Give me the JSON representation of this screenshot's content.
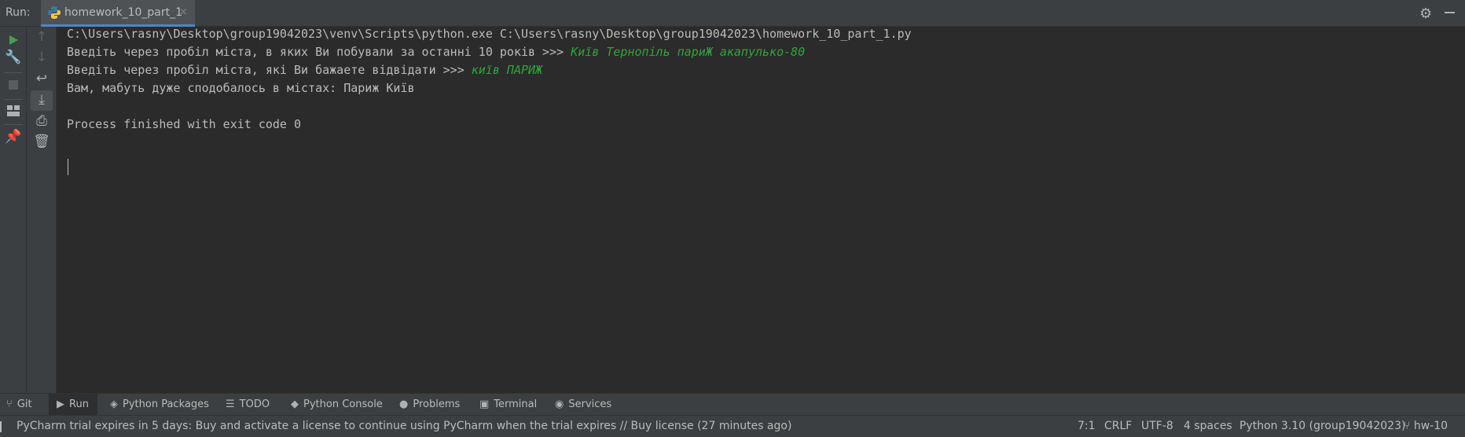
{
  "run_header": {
    "label": "Run:",
    "tab_label": "homework_10_part_1",
    "close_glyph": "×"
  },
  "icons": {
    "run": "run-icon",
    "wrench": "wrench-icon",
    "stop": "stop-icon",
    "layout": "layout-icon",
    "pin": "pin-icon",
    "up": "arrow-up-icon",
    "down": "arrow-down-icon",
    "wrap": "soft-wrap-icon",
    "scroll_end": "scroll-to-end-icon",
    "print": "print-icon",
    "trash": "trash-icon",
    "gear": "gear-icon",
    "minimize": "minimize-icon"
  },
  "colors": {
    "accent": "#4a88c7",
    "run_green": "#499c54",
    "user_input": "#2fa53a",
    "background": "#2b2b2b",
    "panel": "#3c3f41"
  },
  "console": {
    "line1": "C:\\Users\\rasny\\Desktop\\group19042023\\venv\\Scripts\\python.exe C:\\Users\\rasny\\Desktop\\group19042023\\homework_10_part_1.py",
    "line2_prompt": "Введіть через пробіл міста, в яких Ви побували за останні 10 років >>> ",
    "line2_input": "Київ Тернопіль париЖ акапулько-80",
    "line3_prompt": "Введіть через пробіл міста, які Ви бажаете відвідати >>> ",
    "line3_input": "київ ПАРИЖ",
    "line4": "Вам, мабуть дуже сподобалось в містах: Париж Київ",
    "line5": "Process finished with exit code 0"
  },
  "bottom_tabs": [
    "Git",
    "Run",
    "Python Packages",
    "TODO",
    "Python Console",
    "Problems",
    "Terminal",
    "Services"
  ],
  "status_bar": {
    "message": "PyCharm trial expires in 5 days: Buy and activate a license to continue using PyCharm when the trial expires // Buy license (27 minutes ago)",
    "position": "7:1",
    "line_separator": "CRLF",
    "encoding": "UTF-8",
    "indent": "4 spaces",
    "interpreter": "Python 3.10 (group19042023)",
    "branch": "hw-10"
  }
}
